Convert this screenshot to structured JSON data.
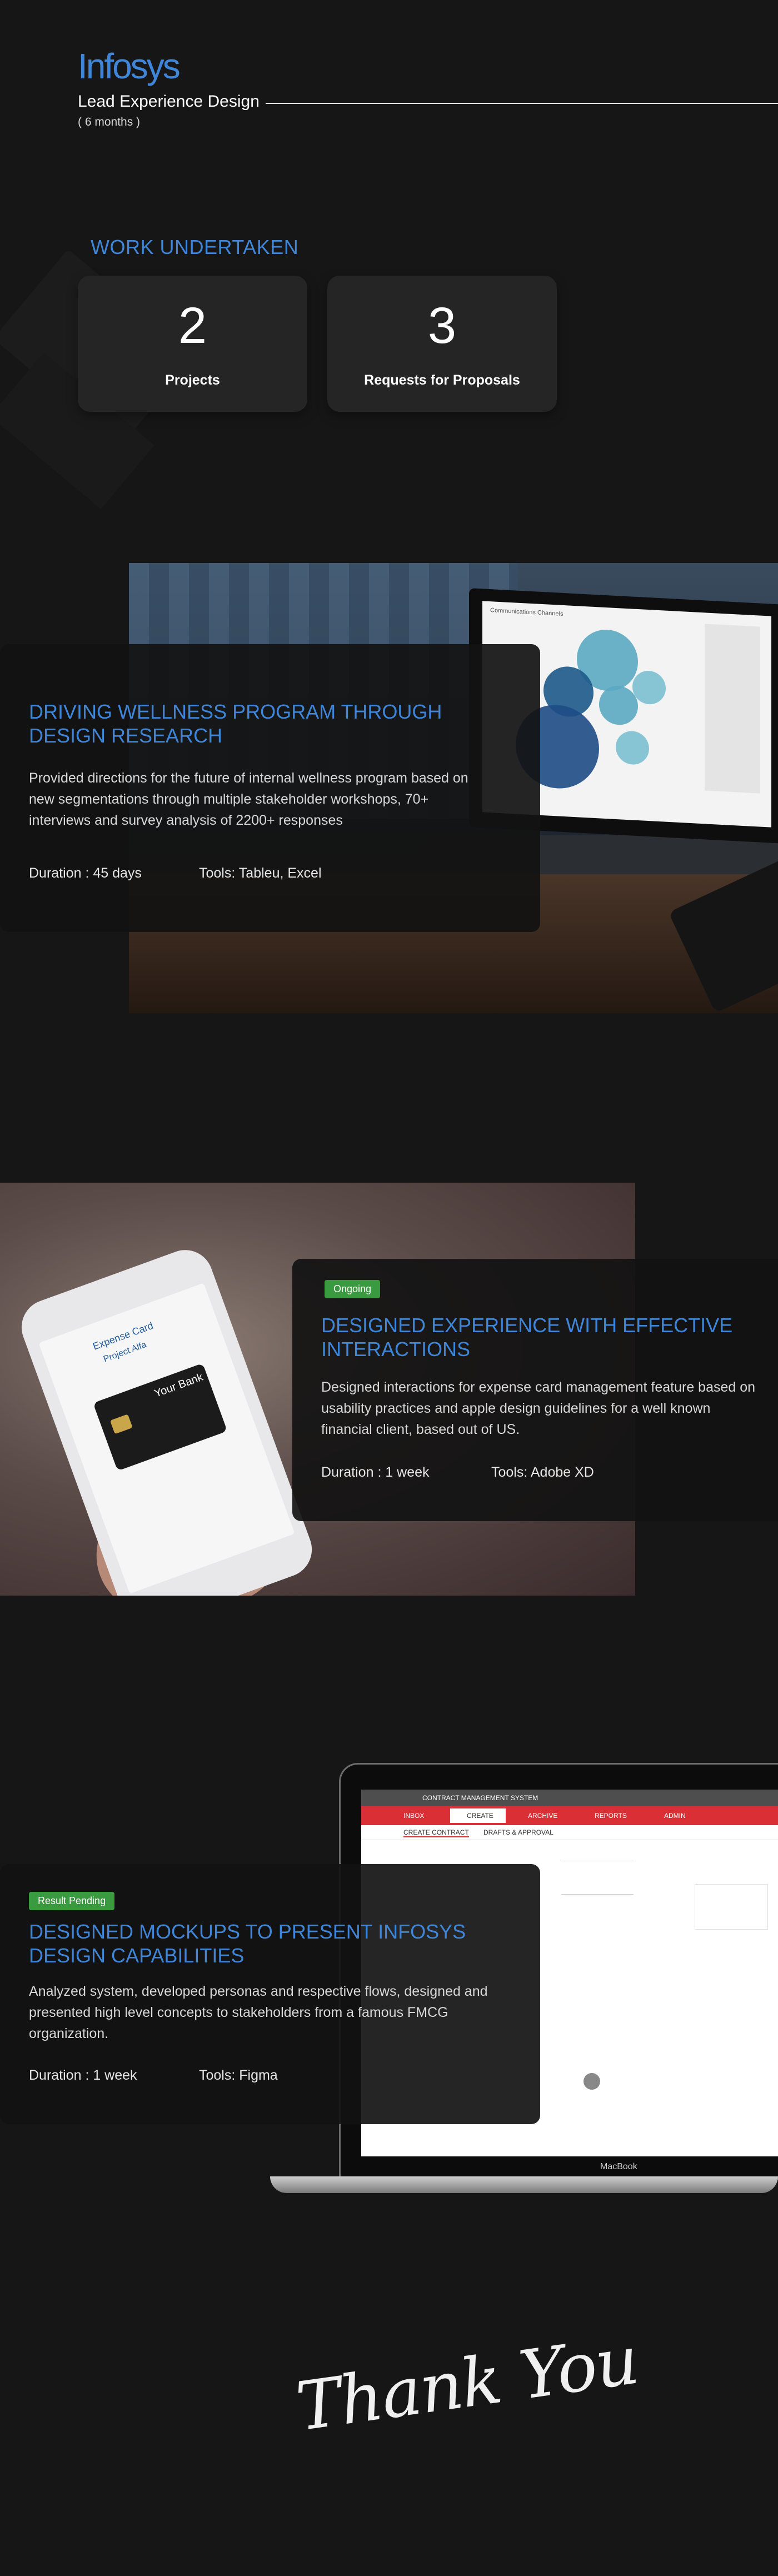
{
  "header": {
    "company": "Infosys",
    "role": "Lead Experience Design",
    "duration": "( 6 months )"
  },
  "work": {
    "title": "WORK UNDERTAKEN",
    "stats": [
      {
        "value": "2",
        "label": "Projects"
      },
      {
        "value": "3",
        "label": "Requests for Proposals"
      }
    ]
  },
  "projects": [
    {
      "title": "DRIVING WELLNESS PROGRAM THROUGH DESIGN RESEARCH",
      "description": "Provided directions for the future of internal wellness program based on new segmentations through multiple stakeholder workshops, 70+ interviews and survey analysis of 2200+ responses",
      "duration": "Duration : 45 days",
      "tools": "Tools: Tableu, Excel",
      "image_caption": "Communications Channels"
    },
    {
      "status": "Ongoing",
      "title": "DESIGNED EXPERIENCE WITH EFFECTIVE INTERACTIONS",
      "description": "Designed interactions for expense card management feature based on usability practices and apple design guidelines for a well known financial client,  based out of US.",
      "duration": "Duration : 1 week",
      "tools": "Tools: Adobe XD",
      "phone_text": {
        "card_title": "Expense Card",
        "subtitle": "Project Alfa",
        "bank": "Your Bank"
      }
    },
    {
      "status": "Result Pending",
      "title": "DESIGNED MOCKUPS TO PRESENT INFOSYS DESIGN CAPABILITIES",
      "description": "Analyzed system, developed personas and respective flows, designed and presented high level concepts to stakeholders from a famous FMCG organization.",
      "duration": "Duration : 1 week",
      "tools": "Tools: Figma",
      "screen": {
        "app_title": "CONTRACT MANAGEMENT SYSTEM",
        "nav": [
          "INBOX",
          "CREATE",
          "ARCHIVE",
          "REPORTS",
          "ADMIN"
        ],
        "tabs": [
          "CREATE CONTRACT",
          "DRAFTS & APPROVAL"
        ],
        "device": "MacBook"
      }
    }
  ],
  "footer": {
    "thanks": "Thank You"
  },
  "colors": {
    "background": "#161616",
    "accent_blue": "#3f86d8",
    "status_green": "#3a9a3f",
    "card": "#252525",
    "screen_red": "#d92f35"
  }
}
